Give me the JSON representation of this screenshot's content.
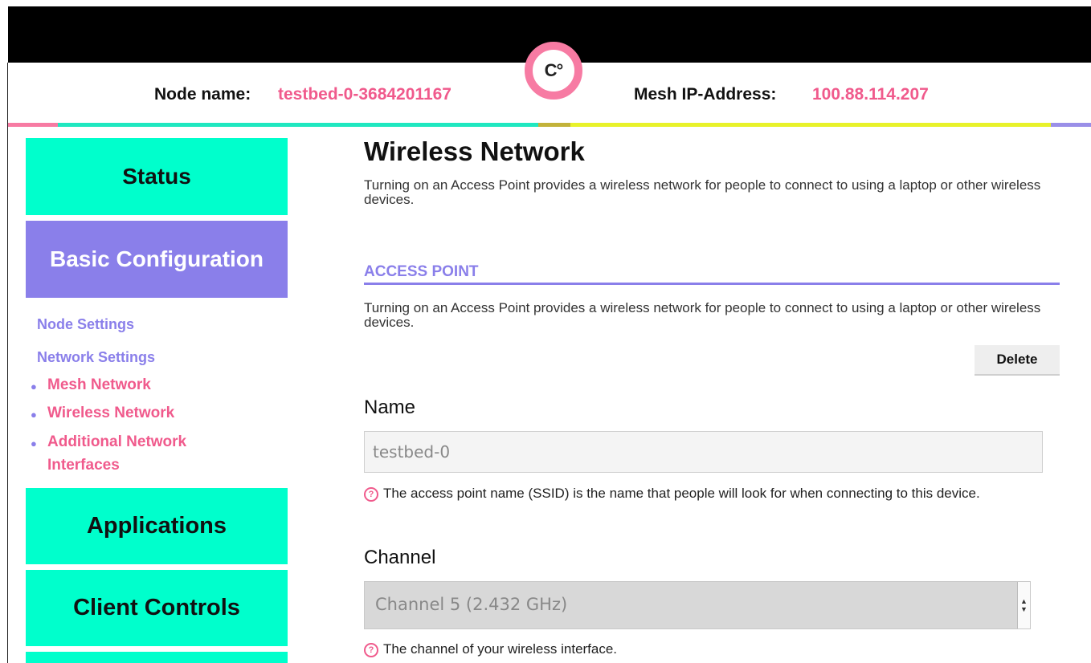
{
  "header": {
    "node_name_label": "Node name:",
    "node_name_value": "testbed-0-3684201167",
    "mesh_ip_label": "Mesh IP-Address:",
    "mesh_ip_value": "100.88.114.207",
    "logo_text": "C°"
  },
  "colors": {
    "teal": "#00ffcc",
    "purple": "#8a7fea",
    "pink": "#f05a8c",
    "yellow": "#e8f22a"
  },
  "sidebar": {
    "status": "Status",
    "basic_configuration": "Basic Configuration",
    "node_settings": "Node Settings",
    "network_settings": "Network Settings",
    "sub_items": [
      "Mesh Network",
      "Wireless Network",
      "Additional Network Interfaces"
    ],
    "applications": "Applications",
    "client_controls": "Client Controls"
  },
  "main": {
    "title": "Wireless Network",
    "description": "Turning on an Access Point provides a wireless network for people to connect to using a laptop or other wireless devices.",
    "section_title": "ACCESS POINT",
    "section_description": "Turning on an Access Point provides a wireless network for people to connect to using a laptop or other wireless devices.",
    "delete_label": "Delete",
    "name_label": "Name",
    "name_value": "testbed-0",
    "name_help": "The access point name (SSID) is the name that people will look for when connecting to this device.",
    "channel_label": "Channel",
    "channel_value": "Channel 5 (2.432 GHz)",
    "channel_help": "The channel of your wireless interface.",
    "help_icon": "?"
  }
}
